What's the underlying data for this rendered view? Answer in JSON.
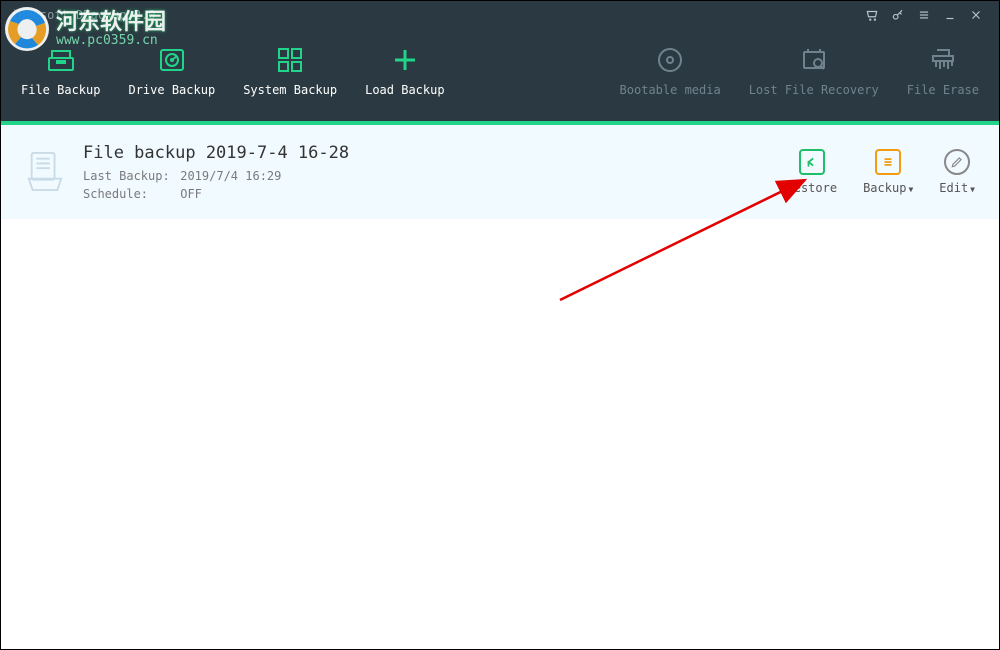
{
  "window": {
    "title": "iBeesoft DBackup 2.0"
  },
  "toolbar": {
    "file_backup": "File Backup",
    "drive_backup": "Drive Backup",
    "system_backup": "System Backup",
    "load_backup": "Load Backup",
    "bootable_media": "Bootable media",
    "lost_file_recovery": "Lost File Recovery",
    "file_erase": "File Erase"
  },
  "backup": {
    "title": "File backup 2019-7-4 16-28",
    "last_backup_label": "Last Backup:",
    "last_backup_value": "2019/7/4 16:29",
    "schedule_label": "Schedule:",
    "schedule_value": "OFF"
  },
  "actions": {
    "restore": "Restore",
    "backup": "Backup",
    "edit": "Edit"
  },
  "watermark": {
    "site_cn": "河东软件园",
    "site_url": "www.pc0359.cn"
  },
  "colors": {
    "accent": "#22d48a",
    "header_bg": "#2b3a42",
    "card_bg": "#f1faff",
    "restore": "#1fbf6a",
    "backup": "#f39c12",
    "edit": "#888"
  }
}
